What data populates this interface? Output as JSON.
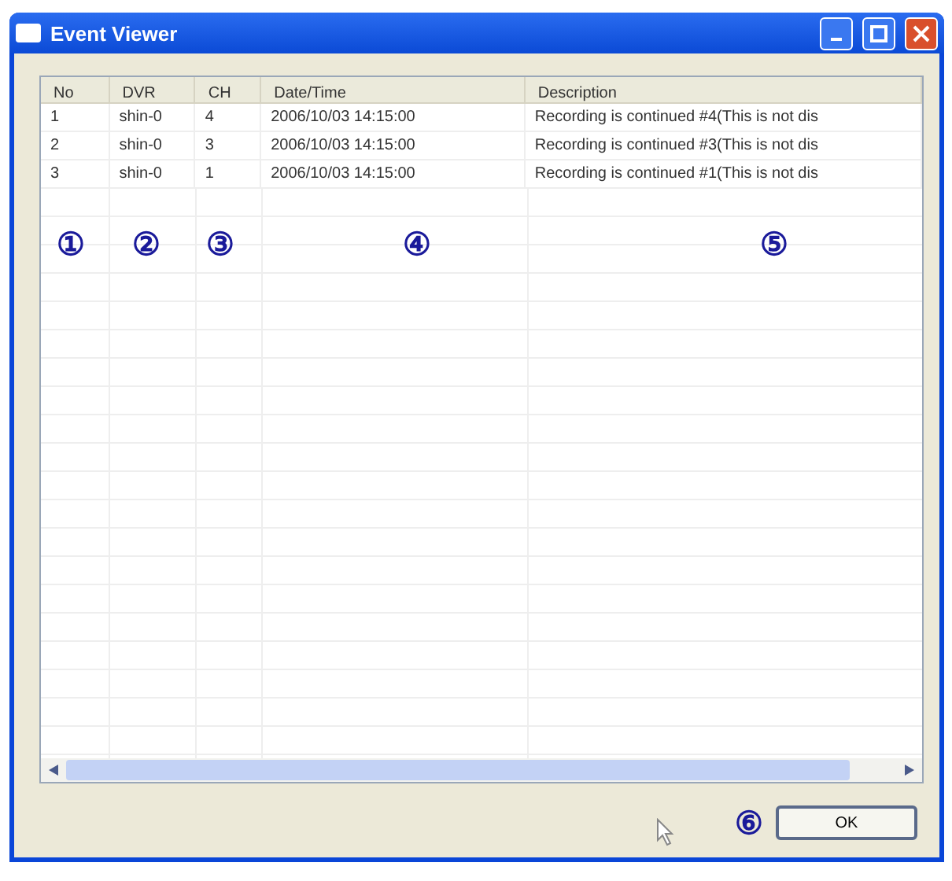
{
  "window": {
    "title": "Event Viewer"
  },
  "table": {
    "columns": [
      "No",
      "DVR",
      "CH",
      "Date/Time",
      "Description"
    ],
    "rows": [
      [
        "1",
        "shin-0",
        "4",
        "2006/10/03 14:15:00",
        "Recording is continued #4(This is not dis"
      ],
      [
        "2",
        "shin-0",
        "3",
        "2006/10/03 14:15:00",
        "Recording is continued #3(This is not dis"
      ],
      [
        "3",
        "shin-0",
        "1",
        "2006/10/03 14:15:00",
        "Recording is continued #1(This is not dis"
      ]
    ]
  },
  "callouts": [
    "①",
    "②",
    "③",
    "④",
    "⑤"
  ],
  "ok_callout": "⑥",
  "buttons": [
    "OK"
  ]
}
